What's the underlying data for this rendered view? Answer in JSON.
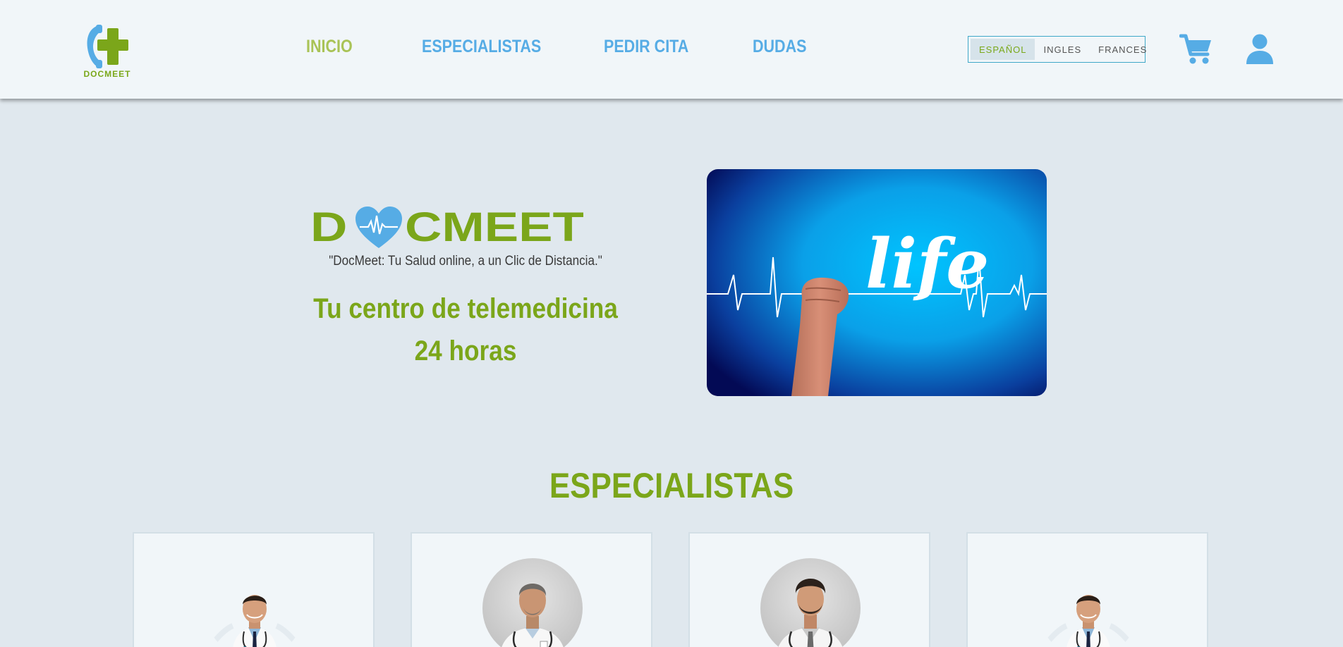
{
  "brand": {
    "name": "DOCMEET"
  },
  "colors": {
    "accent_green": "#7ba61a",
    "accent_blue": "#56ace5",
    "active_nav": "#a9c356"
  },
  "nav": {
    "items": [
      {
        "label": "INICIO",
        "active": true
      },
      {
        "label": "ESPECIALISTAS",
        "active": false
      },
      {
        "label": "PEDIR CITA",
        "active": false
      },
      {
        "label": "DUDAS",
        "active": false
      }
    ]
  },
  "languages": {
    "options": [
      "ESPAÑOL",
      "INGLES",
      "FRANCES"
    ],
    "selected": "ESPAÑOL"
  },
  "icons": {
    "cart": "cart-icon",
    "user": "user-icon"
  },
  "hero": {
    "logo_letters": {
      "d": "D",
      "rest": "CMEET"
    },
    "tagline": "\"DocMeet: Tu Salud online, a un Clic de Distancia.\"",
    "title": "Tu centro de telemedicina 24 horas",
    "image_text": "life"
  },
  "specialists": {
    "title": "ESPECIALISTAS",
    "cards": [
      {
        "photo": "doctor-smiling"
      },
      {
        "photo": "doctor-gray-hair"
      },
      {
        "photo": "doctor-beard"
      },
      {
        "photo": "doctor-smiling"
      }
    ]
  }
}
